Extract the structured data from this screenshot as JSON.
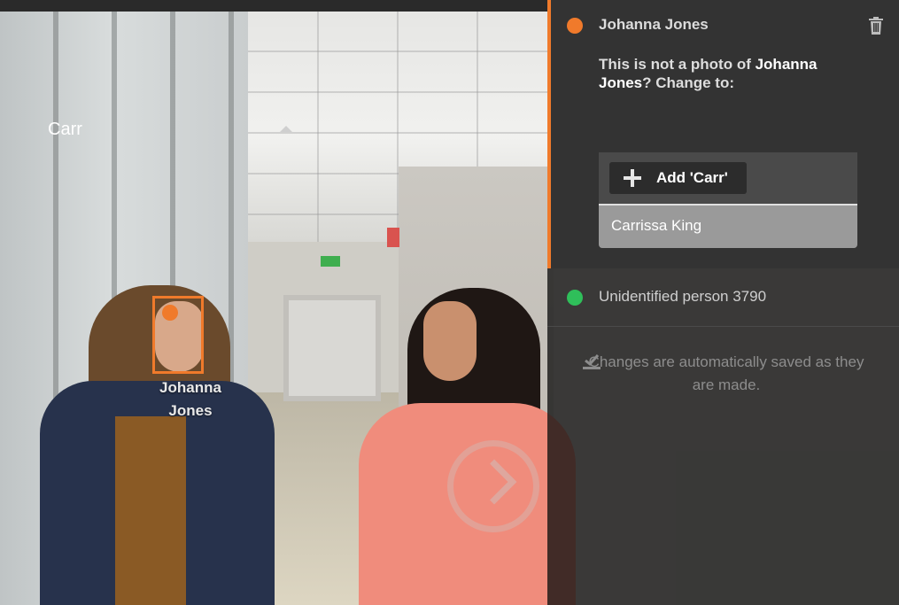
{
  "photo": {
    "face_label": "Johanna Jones"
  },
  "panel": {
    "active_card": {
      "name": "Johanna Jones",
      "dot_color": "#f07a2b",
      "message_prefix": "This is not a photo of ",
      "message_name": "Johanna Jones",
      "message_suffix": "? Change to:",
      "select_value": "Carr",
      "add_button_label": "Add 'Carr'",
      "suggestion": "Carrissa King",
      "delete_icon": "trash-icon"
    },
    "other_card": {
      "name": "Unidentified person 3790",
      "dot_color": "#2fbf5a"
    },
    "saved_note": "Changes are automatically saved as they are made.",
    "saved_icon": "check-icon"
  },
  "colors": {
    "accent": "#f07a2b",
    "panel_bg": "#333333"
  }
}
